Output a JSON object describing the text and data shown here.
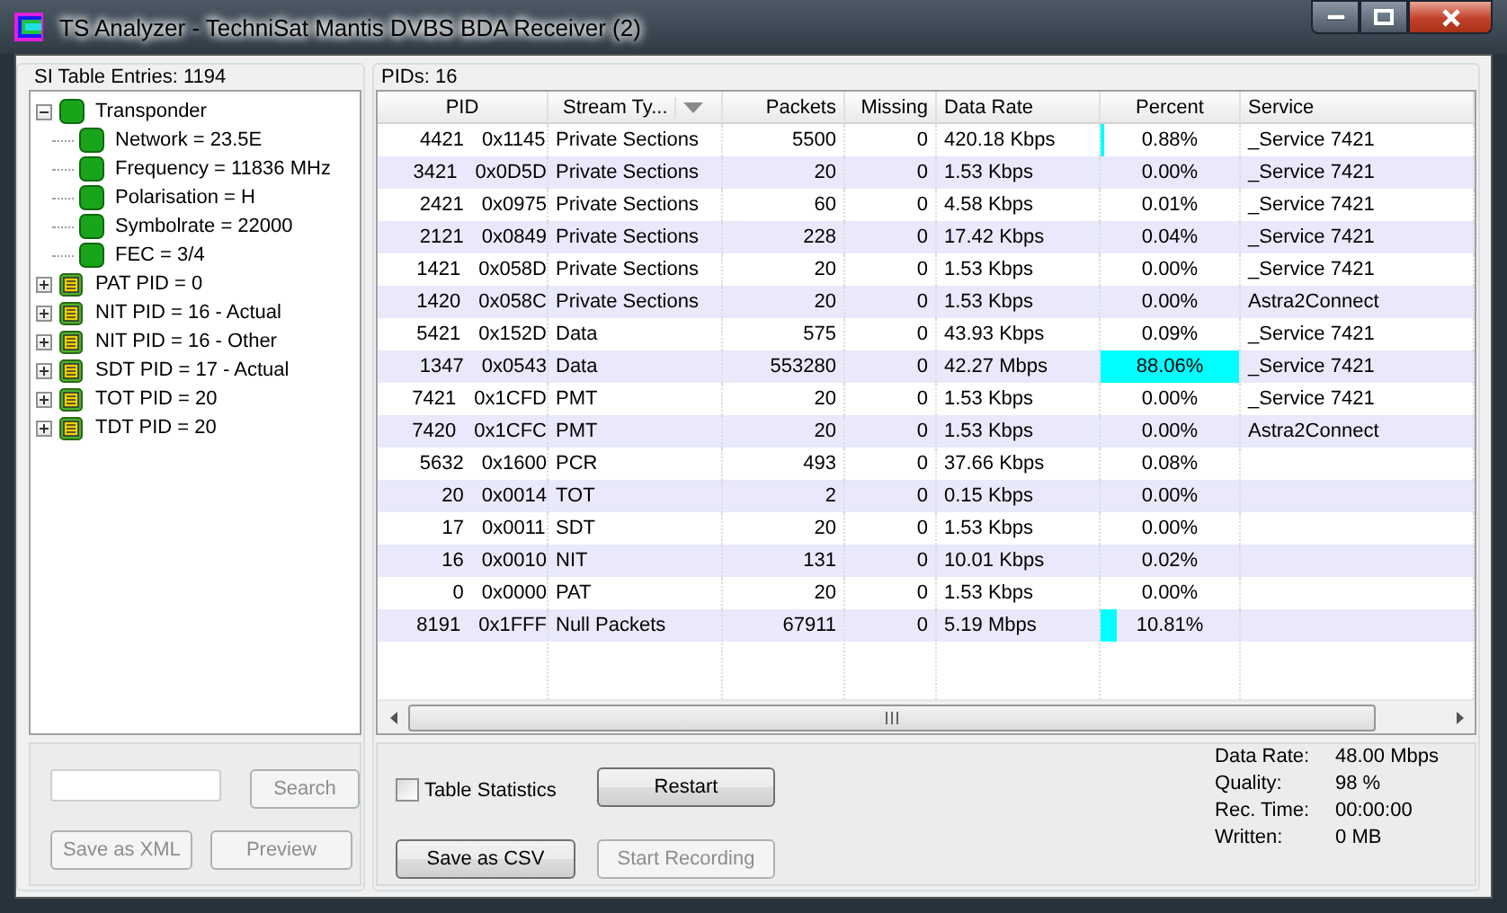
{
  "window": {
    "title": "TS Analyzer - TechniSat Mantis DVBS BDA Receiver (2)"
  },
  "si_table": {
    "label": "SI Table Entries: 1194",
    "tree": [
      {
        "label": "Transponder",
        "kind": "status",
        "expanded": true,
        "children": [
          {
            "label": "Network = 23.5E",
            "kind": "status"
          },
          {
            "label": "Frequency = 11836 MHz",
            "kind": "status"
          },
          {
            "label": "Polarisation = H",
            "kind": "status"
          },
          {
            "label": "Symbolrate = 22000",
            "kind": "status"
          },
          {
            "label": "FEC = 3/4",
            "kind": "status"
          }
        ]
      },
      {
        "label": "PAT PID = 0",
        "kind": "table",
        "expanded": false
      },
      {
        "label": "NIT PID = 16 - Actual",
        "kind": "table",
        "expanded": false
      },
      {
        "label": "NIT PID = 16 - Other",
        "kind": "table",
        "expanded": false
      },
      {
        "label": "SDT PID = 17 - Actual",
        "kind": "table",
        "expanded": false
      },
      {
        "label": "TOT PID = 20",
        "kind": "table",
        "expanded": false
      },
      {
        "label": "TDT PID = 20",
        "kind": "table",
        "expanded": false
      }
    ]
  },
  "search": {
    "button": {
      "label": "Search",
      "disabled": true
    }
  },
  "left_buttons": [
    {
      "label": "Save as XML",
      "disabled": true
    },
    {
      "label": "Preview",
      "disabled": true
    }
  ],
  "pids": {
    "label": "PIDs: 16",
    "columns": [
      "PID",
      "Stream Ty...",
      "Packets",
      "Missing",
      "Data Rate",
      "Percent",
      "Service"
    ],
    "rows": [
      {
        "pid": "4421",
        "hex": "0x1145",
        "type": "Private Sections",
        "packets": "5500",
        "missing": "0",
        "rate": "420.18 Kbps",
        "percent": "0.88%",
        "level": 0.025,
        "service": "_Service 7421"
      },
      {
        "pid": "3421",
        "hex": "0x0D5D",
        "type": "Private Sections",
        "packets": "20",
        "missing": "0",
        "rate": "1.53 Kbps",
        "percent": "0.00%",
        "service": "_Service 7421"
      },
      {
        "pid": "2421",
        "hex": "0x0975",
        "type": "Private Sections",
        "packets": "60",
        "missing": "0",
        "rate": "4.58 Kbps",
        "percent": "0.01%",
        "service": "_Service 7421"
      },
      {
        "pid": "2121",
        "hex": "0x0849",
        "type": "Private Sections",
        "packets": "228",
        "missing": "0",
        "rate": "17.42 Kbps",
        "percent": "0.04%",
        "service": "_Service 7421"
      },
      {
        "pid": "1421",
        "hex": "0x058D",
        "type": "Private Sections",
        "packets": "20",
        "missing": "0",
        "rate": "1.53 Kbps",
        "percent": "0.00%",
        "service": "_Service 7421"
      },
      {
        "pid": "1420",
        "hex": "0x058C",
        "type": "Private Sections",
        "packets": "20",
        "missing": "0",
        "rate": "1.53 Kbps",
        "percent": "0.00%",
        "service": "Astra2Connect"
      },
      {
        "pid": "5421",
        "hex": "0x152D",
        "type": "Data",
        "packets": "575",
        "missing": "0",
        "rate": "43.93 Kbps",
        "percent": "0.09%",
        "service": "_Service 7421"
      },
      {
        "pid": "1347",
        "hex": "0x0543",
        "type": "Data",
        "packets": "553280",
        "missing": "0",
        "rate": "42.27 Mbps",
        "percent": "88.06%",
        "level": 1,
        "service": "_Service 7421"
      },
      {
        "pid": "7421",
        "hex": "0x1CFD",
        "type": "PMT",
        "packets": "20",
        "missing": "0",
        "rate": "1.53 Kbps",
        "percent": "0.00%",
        "service": "_Service 7421"
      },
      {
        "pid": "7420",
        "hex": "0x1CFC",
        "type": "PMT",
        "packets": "20",
        "missing": "0",
        "rate": "1.53 Kbps",
        "percent": "0.00%",
        "service": "Astra2Connect"
      },
      {
        "pid": "5632",
        "hex": "0x1600",
        "type": "PCR",
        "packets": "493",
        "missing": "0",
        "rate": "37.66 Kbps",
        "percent": "0.08%"
      },
      {
        "pid": "20",
        "hex": "0x0014",
        "type": "TOT",
        "packets": "2",
        "missing": "0",
        "rate": "0.15 Kbps",
        "percent": "0.00%"
      },
      {
        "pid": "17",
        "hex": "0x0011",
        "type": "SDT",
        "packets": "20",
        "missing": "0",
        "rate": "1.53 Kbps",
        "percent": "0.00%"
      },
      {
        "pid": "16",
        "hex": "0x0010",
        "type": "NIT",
        "packets": "131",
        "missing": "0",
        "rate": "10.01 Kbps",
        "percent": "0.02%"
      },
      {
        "pid": "0",
        "hex": "0x0000",
        "type": "PAT",
        "packets": "20",
        "missing": "0",
        "rate": "1.53 Kbps",
        "percent": "0.00%"
      },
      {
        "pid": "8191",
        "hex": "0x1FFF",
        "type": "Null Packets",
        "packets": "67911",
        "missing": "0",
        "rate": "5.19 Mbps",
        "percent": "10.81%",
        "level": 0.12
      }
    ]
  },
  "table_statistics": {
    "label": "Table Statistics",
    "checked": false
  },
  "buttons": [
    {
      "label": "Restart",
      "disabled": false
    },
    {
      "label": "Save as CSV",
      "disabled": false
    },
    {
      "label": "Start Recording",
      "disabled": true
    }
  ],
  "stats": [
    {
      "label": "Data Rate:",
      "value": "48.00 Mbps"
    },
    {
      "label": "Quality:",
      "value": "98 %"
    },
    {
      "label": "Rec. Time:",
      "value": "00:00:00"
    },
    {
      "label": "Written:",
      "value": "0 MB"
    }
  ]
}
